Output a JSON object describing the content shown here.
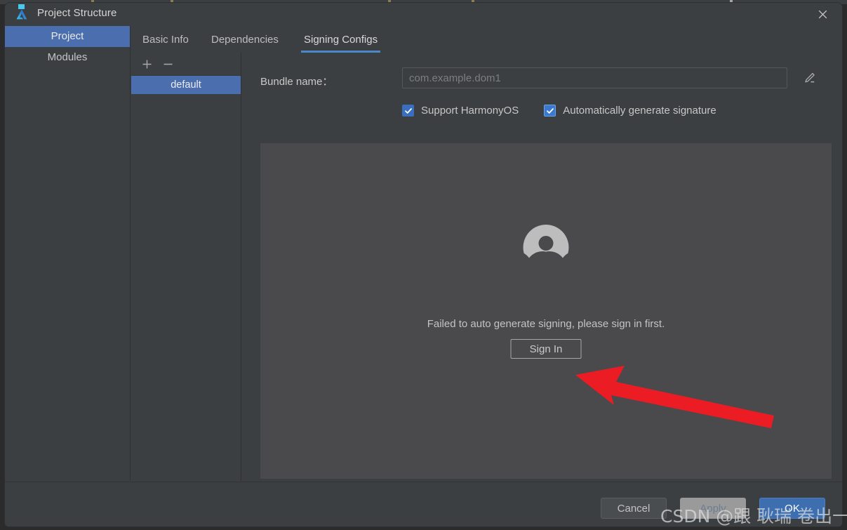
{
  "window": {
    "title": "Project Structure",
    "logo_icon": "deveco-logo-icon",
    "close_icon": "close-icon"
  },
  "sidebar": {
    "items": [
      {
        "label": "Project",
        "selected": true
      },
      {
        "label": "Modules",
        "selected": false
      }
    ]
  },
  "tabs": [
    {
      "label": "Basic Info",
      "active": false
    },
    {
      "label": "Dependencies",
      "active": false
    },
    {
      "label": "Signing Configs",
      "active": true
    }
  ],
  "configs_panel": {
    "add_icon": "plus-icon",
    "remove_icon": "minus-icon",
    "items": [
      {
        "label": "default",
        "selected": true
      }
    ]
  },
  "form": {
    "bundle_name_label": "Bundle name：",
    "bundle_name_value": "",
    "bundle_name_placeholder": "com.example.dom1",
    "edit_icon": "pencil-edit-icon",
    "checkboxes": [
      {
        "label": "Support HarmonyOS",
        "checked": true,
        "focused": false
      },
      {
        "label": "Automatically generate signature",
        "checked": true,
        "focused": true
      }
    ]
  },
  "signing_panel": {
    "avatar_icon": "user-avatar-icon",
    "message": "Failed to auto generate signing, please sign in first.",
    "sign_in_label": "Sign In"
  },
  "annotation": {
    "arrow_icon": "red-arrow-icon",
    "arrow_color": "#ec1c24"
  },
  "footer": {
    "cancel_label": "Cancel",
    "apply_label": "Apply",
    "ok_label": "OK"
  },
  "watermark": {
    "text": "CSDN @跟 耿瑞 卷出一片天"
  },
  "colors": {
    "window_bg": "#3c3f41",
    "panel_bg": "#4a4a4c",
    "accent_blue": "#4b6eaf",
    "tab_underline": "#4a88c7",
    "ok_button": "#3c6eb0",
    "checkbox_blue": "#3a6fbf"
  }
}
